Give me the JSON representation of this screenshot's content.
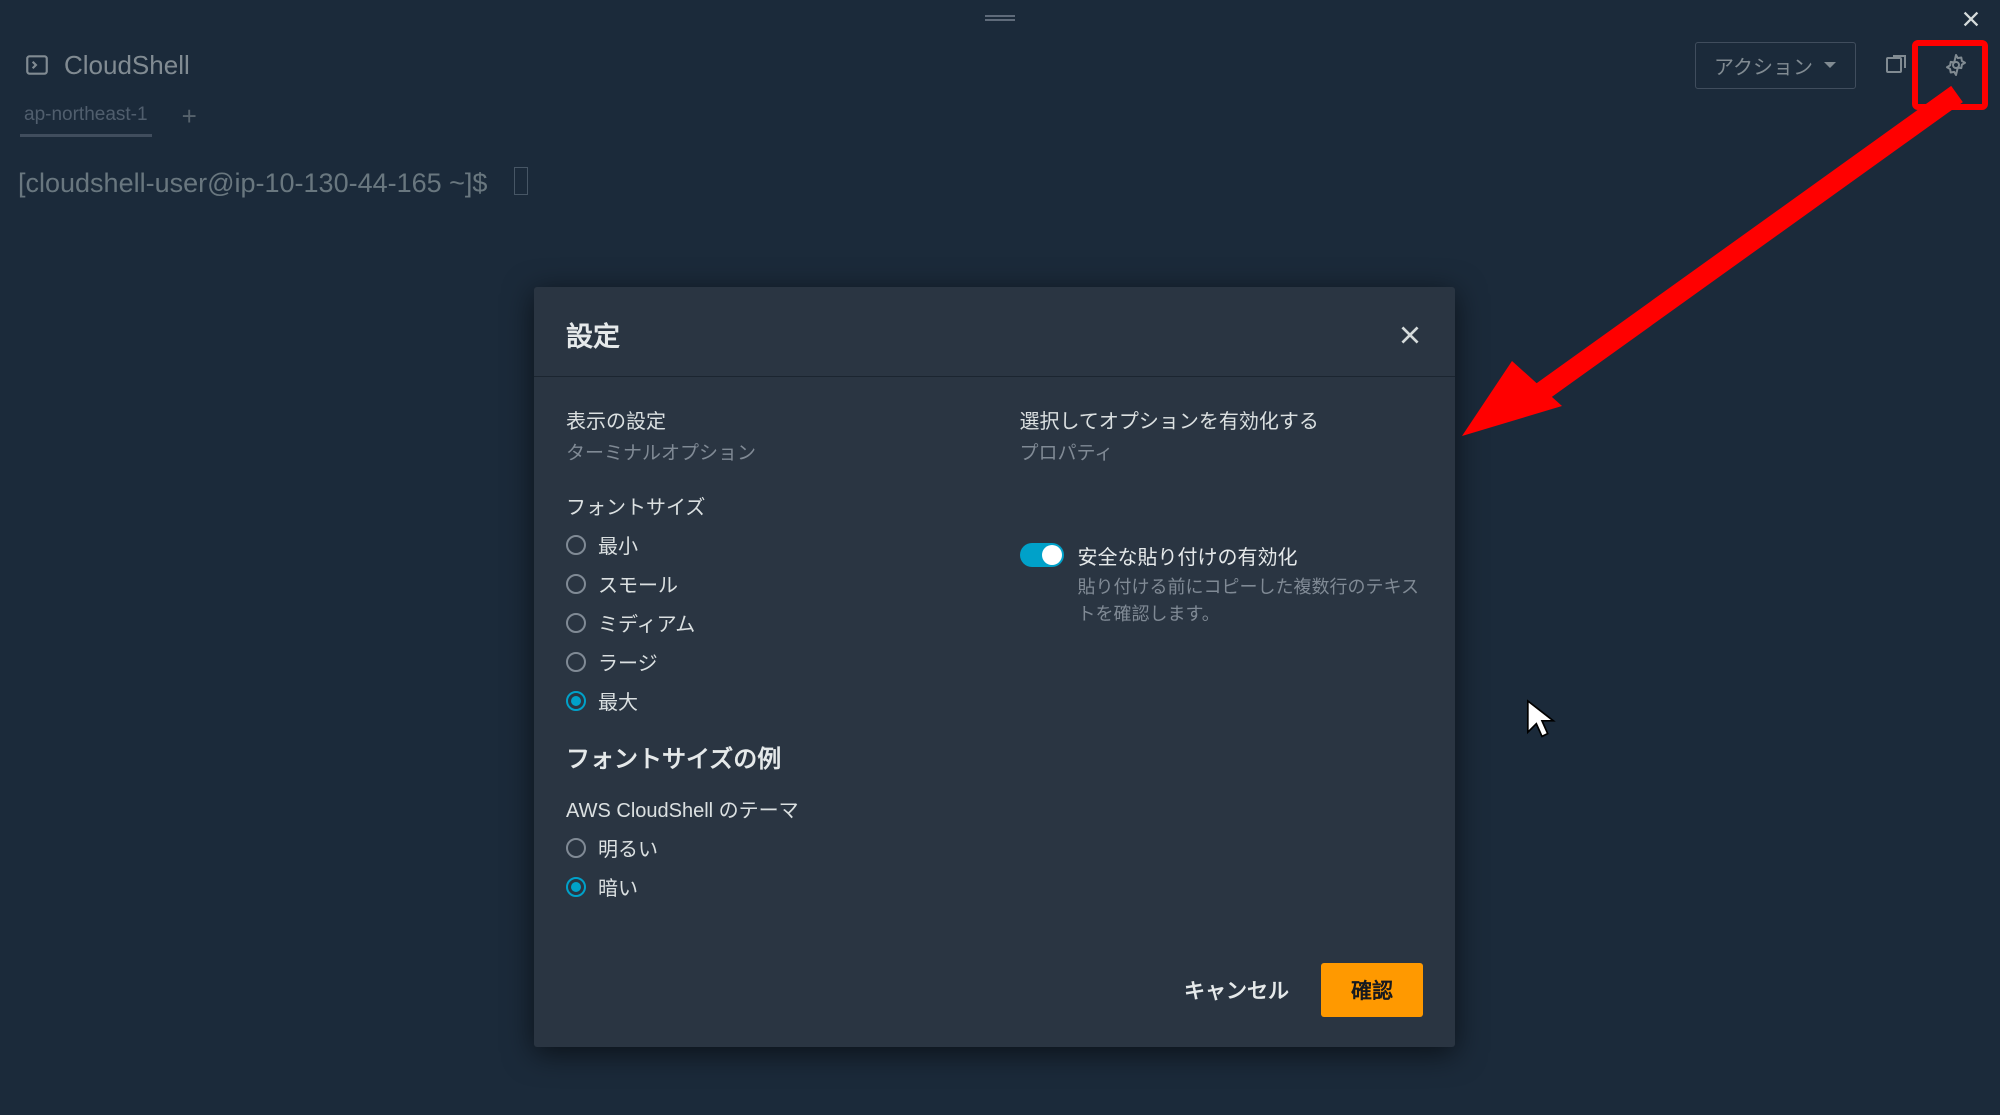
{
  "app": {
    "title": "CloudShell"
  },
  "header": {
    "actions_label": "アクション"
  },
  "tabs": {
    "active": "ap-northeast-1"
  },
  "terminal": {
    "prompt": "[cloudshell-user@ip-10-130-44-165 ~]$"
  },
  "modal": {
    "title": "設定",
    "left": {
      "section_title": "表示の設定",
      "section_sub": "ターミナルオプション",
      "font_size_label": "フォントサイズ",
      "font_options": [
        {
          "label": "最小",
          "checked": false
        },
        {
          "label": "スモール",
          "checked": false
        },
        {
          "label": "ミディアム",
          "checked": false
        },
        {
          "label": "ラージ",
          "checked": false
        },
        {
          "label": "最大",
          "checked": true
        }
      ],
      "example_heading": "フォントサイズの例",
      "theme_label": "AWS CloudShell のテーマ",
      "theme_options": [
        {
          "label": "明るい",
          "checked": false
        },
        {
          "label": "暗い",
          "checked": true
        }
      ]
    },
    "right": {
      "section_title": "選択してオプションを有効化する",
      "section_sub": "プロパティ",
      "toggle_title": "安全な貼り付けの有効化",
      "toggle_desc": "貼り付ける前にコピーした複数行のテキストを確認します。"
    },
    "footer": {
      "cancel": "キャンセル",
      "confirm": "確認"
    }
  }
}
